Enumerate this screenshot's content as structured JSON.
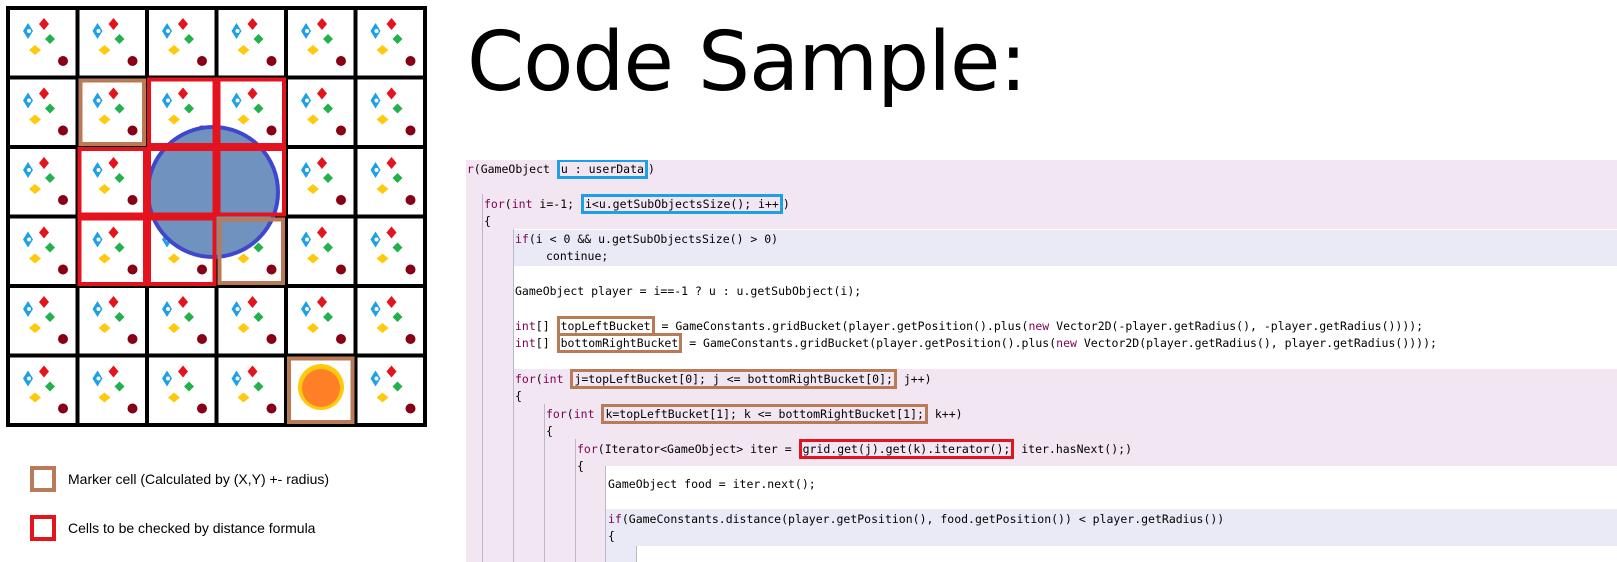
{
  "title": "Code Sample:",
  "legend": [
    {
      "label": "Marker cell (Calculated by (X,Y) +- radius)",
      "color": "#b97a57"
    },
    {
      "label": "Cells to be checked by distance formula",
      "color": "#e4141e"
    }
  ],
  "grid": {
    "rows": 6,
    "cols": 6,
    "marker_cells": [
      [
        1,
        1
      ],
      [
        3,
        3
      ],
      [
        5,
        4
      ]
    ],
    "check_cells": [
      [
        1,
        2
      ],
      [
        1,
        3
      ],
      [
        2,
        1
      ],
      [
        2,
        2
      ],
      [
        2,
        3
      ],
      [
        3,
        1
      ],
      [
        3,
        2
      ]
    ],
    "colors": {
      "blue": "#1ea0e6",
      "red": "#e4141e",
      "green": "#22b14c",
      "yellow": "#ffc90e",
      "darkred": "#880015",
      "circle_fill": "#7092be",
      "circle_stroke": "#3f48cc",
      "food_fill": "#ff7f27",
      "food_ring": "#ffc90e"
    }
  },
  "code": {
    "l1": {
      "a": "for",
      "b": "(GameObject ",
      "box": "u : userData",
      "c": ")"
    },
    "l2": "{",
    "l3": {
      "a": "for",
      "b": "(",
      "kw": "int",
      "c": " i=-1; ",
      "box": "i<u.getSubObjectsSize(); i++",
      "d": ")"
    },
    "l4": "{",
    "l5": {
      "a": "if",
      "b": "(i < 0 && u.getSubObjectsSize() > 0)"
    },
    "l6": "continue;",
    "l7": "GameObject player = i==-1 ? u : u.getSubObject(i);",
    "l8": {
      "kw": "int",
      "b": "[] ",
      "box": "topLeftBucket",
      "c": " = GameConstants.gridBucket(player.getPosition().plus(",
      "new": "new",
      "d": " Vector2D(-player.getRadius(), -player.getRadius())));"
    },
    "l9": {
      "kw": "int",
      "b": "[] ",
      "box": "bottomRightBucket",
      "c": " = GameConstants.gridBucket(player.getPosition().plus(",
      "new": "new",
      "d": " Vector2D(player.getRadius(), player.getRadius())));"
    },
    "l10": {
      "a": "for",
      "b": "(",
      "kw": "int",
      "c": " ",
      "box": "j=topLeftBucket[0]; j <= bottomRightBucket[0];",
      "d": " j++)"
    },
    "l11": "{",
    "l12": {
      "a": "for",
      "b": "(",
      "kw": "int",
      "c": " ",
      "box": "k=topLeftBucket[1]; k <= bottomRightBucket[1];",
      "d": " k++)"
    },
    "l13": "{",
    "l14": {
      "a": "for",
      "b": "(Iterator<GameObject> iter = ",
      "box": "grid.get(j).get(k).iterator();",
      "c": " iter.hasNext();)"
    },
    "l15": "{",
    "l16": "GameObject food = iter.next();",
    "l17": {
      "a": "if",
      "b": "(GameConstants.distance(player.getPosition(), food.getPosition()) < player.getRadius())"
    },
    "l18": "{"
  }
}
